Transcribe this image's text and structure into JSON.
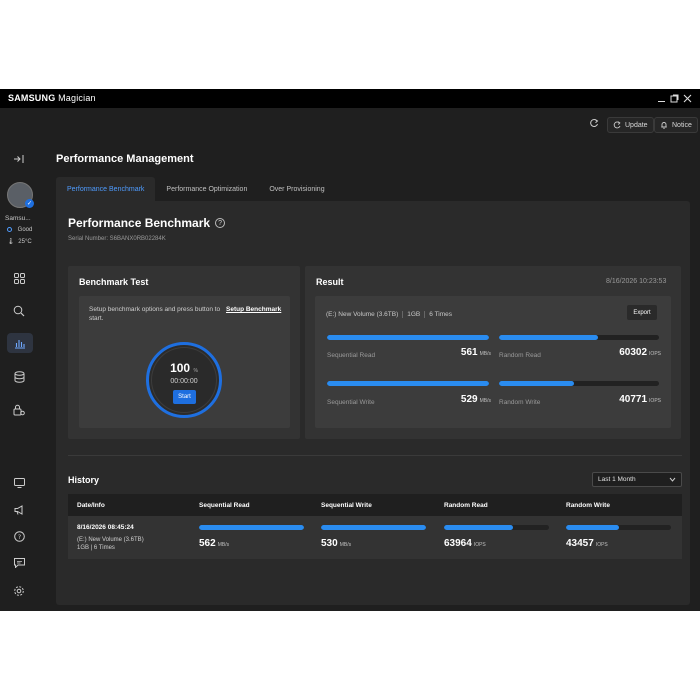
{
  "app": {
    "brand": "SAMSUNG",
    "name": "Magician"
  },
  "toolbar": {
    "update_label": "Update",
    "notice_label": "Notice"
  },
  "sidebar": {
    "drive_name": "Samsu...",
    "health": "Good",
    "temperature": "25°C"
  },
  "main": {
    "title": "Performance Management",
    "tabs": [
      {
        "label": "Performance Benchmark",
        "active": true
      },
      {
        "label": "Performance Optimization",
        "active": false
      },
      {
        "label": "Over Provisioning",
        "active": false
      }
    ]
  },
  "benchmark": {
    "title": "Performance Benchmark",
    "serial_label": "Serial Number: S6BANX0RB02284K",
    "test": {
      "title": "Benchmark Test",
      "instructions": "Setup benchmark options and press button to start.",
      "setup_link": "Setup Benchmark",
      "progress_value": "100",
      "progress_unit": "%",
      "elapsed": "00:00:00",
      "start_label": "Start"
    },
    "result": {
      "title": "Result",
      "timestamp": "8/16/2026 10:23:53",
      "volume": "(E:) New Volume (3.6TB)",
      "size": "1GB",
      "times": "6 Times",
      "export_label": "Export",
      "metrics": [
        {
          "label": "Sequential Read",
          "value": "561",
          "unit": "MB/s",
          "fill": 1.0
        },
        {
          "label": "Random Read",
          "value": "60302",
          "unit": "IOPS",
          "fill": 0.62
        },
        {
          "label": "Sequential Write",
          "value": "529",
          "unit": "MB/s",
          "fill": 1.0
        },
        {
          "label": "Random Write",
          "value": "40771",
          "unit": "IOPS",
          "fill": 0.47
        }
      ]
    }
  },
  "history": {
    "title": "History",
    "filter": "Last 1 Month",
    "columns": [
      "Date/Info",
      "Sequential Read",
      "Sequential Write",
      "Random Read",
      "Random Write"
    ],
    "rows": [
      {
        "date": "8/16/2026 08:45:24",
        "volume": "(E:) New Volume (3.6TB)",
        "details": "1GB | 6 Times",
        "values": [
          {
            "value": "562",
            "unit": "MB/s",
            "fill": 1.0
          },
          {
            "value": "530",
            "unit": "MB/s",
            "fill": 1.0
          },
          {
            "value": "63964",
            "unit": "IOPS",
            "fill": 0.66
          },
          {
            "value": "43457",
            "unit": "IOPS",
            "fill": 0.5
          }
        ]
      }
    ]
  },
  "colors": {
    "accent": "#1e6fe0",
    "bar": "#2a8cf0",
    "background": "#1f1f1f",
    "panel": "#2a2a2a"
  },
  "icons": {
    "sidebar": [
      "collapse-icon",
      "dashboard-icon",
      "search-icon",
      "benchmark-icon",
      "storage-icon",
      "security-icon",
      "display-icon",
      "announce-icon",
      "help-icon",
      "chat-icon",
      "settings-icon"
    ]
  }
}
